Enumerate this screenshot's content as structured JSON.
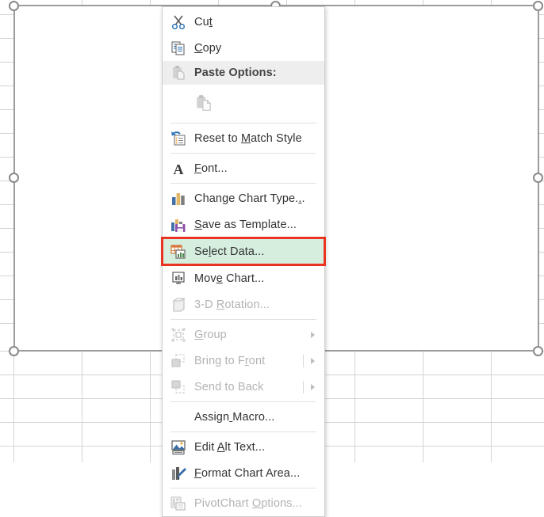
{
  "app": {
    "context": "excel-chart-context-menu",
    "selected_object": "chart-area"
  },
  "colors": {
    "highlight_border": "#ea3323",
    "highlight_fill": "#d6eede",
    "menu_bg": "#ffffff",
    "menu_border": "#cfcfcf",
    "header_bg": "#eeeeee",
    "text": "#333333",
    "text_disabled": "#b3b3b3",
    "gridline": "#d4d4d4",
    "selection_frame": "#9c9c9c"
  },
  "context_menu": {
    "items": [
      {
        "id": "cut",
        "label": "Cut",
        "accel_index": 2,
        "icon": "scissors-icon",
        "disabled": false,
        "submenu": false,
        "type": "item"
      },
      {
        "id": "copy",
        "label": "Copy",
        "accel_index": 0,
        "icon": "copy-icon",
        "disabled": false,
        "submenu": false,
        "type": "item"
      },
      {
        "id": "paste-options",
        "label": "Paste Options:",
        "accel_index": -1,
        "icon": "paste-icon",
        "disabled": true,
        "submenu": false,
        "type": "header"
      },
      {
        "id": "paste-gallery",
        "label": "",
        "accel_index": -1,
        "icon": "paste-keep-source-icon",
        "disabled": true,
        "submenu": false,
        "type": "gallery"
      },
      {
        "id": "separator-1",
        "label": "",
        "accel_index": -1,
        "icon": "",
        "disabled": false,
        "submenu": false,
        "type": "separator"
      },
      {
        "id": "reset-to-match-style",
        "label": "Reset to Match Style",
        "accel_index": 9,
        "icon": "reset-style-icon",
        "disabled": false,
        "submenu": false,
        "type": "item"
      },
      {
        "id": "separator-2",
        "label": "",
        "accel_index": -1,
        "icon": "",
        "disabled": false,
        "submenu": false,
        "type": "separator"
      },
      {
        "id": "font",
        "label": "Font...",
        "accel_index": 0,
        "icon": "font-icon",
        "disabled": false,
        "submenu": false,
        "type": "item"
      },
      {
        "id": "separator-3",
        "label": "",
        "accel_index": -1,
        "icon": "",
        "disabled": false,
        "submenu": false,
        "type": "separator"
      },
      {
        "id": "change-chart-type",
        "label": "Change Chart Type...",
        "accel_index": 18,
        "icon": "chart-type-icon",
        "disabled": false,
        "submenu": false,
        "type": "item"
      },
      {
        "id": "save-as-template",
        "label": "Save as Template...",
        "accel_index": 0,
        "icon": "save-template-icon",
        "disabled": false,
        "submenu": false,
        "type": "item"
      },
      {
        "id": "select-data",
        "label": "Select Data...",
        "accel_index": 2,
        "icon": "select-data-icon",
        "disabled": false,
        "submenu": false,
        "type": "item",
        "highlighted": true
      },
      {
        "id": "move-chart",
        "label": "Move Chart...",
        "accel_index": 3,
        "icon": "move-chart-icon",
        "disabled": false,
        "submenu": false,
        "type": "item"
      },
      {
        "id": "3d-rotation",
        "label": "3-D Rotation...",
        "accel_index": 4,
        "icon": "rotation-3d-icon",
        "disabled": true,
        "submenu": false,
        "type": "item"
      },
      {
        "id": "separator-4",
        "label": "",
        "accel_index": -1,
        "icon": "",
        "disabled": false,
        "submenu": false,
        "type": "separator"
      },
      {
        "id": "group",
        "label": "Group",
        "accel_index": 0,
        "icon": "group-icon",
        "disabled": true,
        "submenu": true,
        "type": "item"
      },
      {
        "id": "bring-to-front",
        "label": "Bring to Front",
        "accel_index": 10,
        "icon": "bring-front-icon",
        "disabled": true,
        "submenu": true,
        "type": "item",
        "divider": true
      },
      {
        "id": "send-to-back",
        "label": "Send to Back",
        "accel_index": 12,
        "icon": "send-back-icon",
        "disabled": true,
        "submenu": true,
        "type": "item",
        "divider": true
      },
      {
        "id": "separator-5",
        "label": "",
        "accel_index": -1,
        "icon": "",
        "disabled": false,
        "submenu": false,
        "type": "separator"
      },
      {
        "id": "assign-macro",
        "label": "Assign Macro...",
        "accel_index": 6,
        "icon": "",
        "disabled": false,
        "submenu": false,
        "type": "item"
      },
      {
        "id": "separator-6",
        "label": "",
        "accel_index": -1,
        "icon": "",
        "disabled": false,
        "submenu": false,
        "type": "separator"
      },
      {
        "id": "edit-alt-text",
        "label": "Edit Alt Text...",
        "accel_index": 5,
        "icon": "alt-text-icon",
        "disabled": false,
        "submenu": false,
        "type": "item"
      },
      {
        "id": "format-chart-area",
        "label": "Format Chart Area...",
        "accel_index": 0,
        "icon": "format-chart-icon",
        "disabled": false,
        "submenu": false,
        "type": "item"
      },
      {
        "id": "separator-7",
        "label": "",
        "accel_index": -1,
        "icon": "",
        "disabled": false,
        "submenu": false,
        "type": "separator"
      },
      {
        "id": "pivotchart-options",
        "label": "PivotChart Options...",
        "accel_index": 11,
        "icon": "pivotchart-icon",
        "disabled": true,
        "submenu": false,
        "type": "item"
      }
    ]
  },
  "worksheet": {
    "chart_selected": true,
    "handle_count": 8
  }
}
